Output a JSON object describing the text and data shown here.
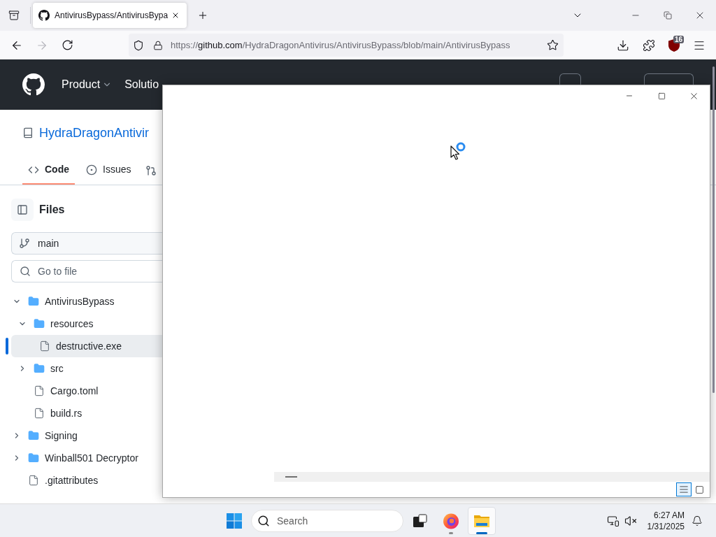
{
  "browser": {
    "tabs": [
      {
        "title": "AntivirusBypass/AntivirusBypa",
        "selected": true
      }
    ],
    "forward_disabled": true,
    "address": {
      "scheme": "https://",
      "domain": "github.com",
      "path": "/HydraDragonAntivirus/AntivirusBypass/blob/main/AntivirusBypass"
    },
    "extension_badge": "16"
  },
  "github": {
    "nav": [
      {
        "label": "Product",
        "caret": true
      },
      {
        "label": "Solutio",
        "caret": false
      }
    ],
    "repo_name": "HydraDragonAntivir",
    "repo_tabs": [
      {
        "label": "Code",
        "kind": "code",
        "selected": true
      },
      {
        "label": "Issues",
        "kind": "issues",
        "selected": false
      }
    ],
    "files_title": "Files",
    "branch": "main",
    "file_search": {
      "placeholder": "Go to file"
    },
    "tree": [
      {
        "name": "AntivirusBypass",
        "kind": "folder",
        "expanded": true,
        "selected": false,
        "children": [
          {
            "name": "resources",
            "kind": "folder",
            "expanded": true,
            "selected": false,
            "children": [
              {
                "name": "destructive.exe",
                "kind": "file",
                "selected": true
              }
            ]
          },
          {
            "name": "src",
            "kind": "folder",
            "expanded": false,
            "selected": false
          },
          {
            "name": "Cargo.toml",
            "kind": "file",
            "selected": false
          },
          {
            "name": "build.rs",
            "kind": "file",
            "selected": false
          }
        ]
      },
      {
        "name": "Signing",
        "kind": "folder",
        "expanded": false,
        "selected": false
      },
      {
        "name": "Winball501 Decryptor",
        "kind": "folder",
        "expanded": false,
        "selected": false
      },
      {
        "name": ".gitattributes",
        "kind": "file",
        "selected": false
      }
    ]
  },
  "overlay_window": {
    "busy": true,
    "view_buttons": [
      {
        "kind": "details",
        "selected": true
      },
      {
        "kind": "large_icons",
        "selected": false
      }
    ]
  },
  "taskbar": {
    "search": {
      "placeholder": "Search"
    },
    "apps": [
      {
        "kind": "task_view",
        "running": false,
        "active": false
      },
      {
        "kind": "browser",
        "running": true,
        "active": false
      },
      {
        "kind": "file_explorer",
        "running": true,
        "active": true
      }
    ],
    "clock": {
      "time": "6:27 AM",
      "date": "1/31/2025"
    }
  }
}
